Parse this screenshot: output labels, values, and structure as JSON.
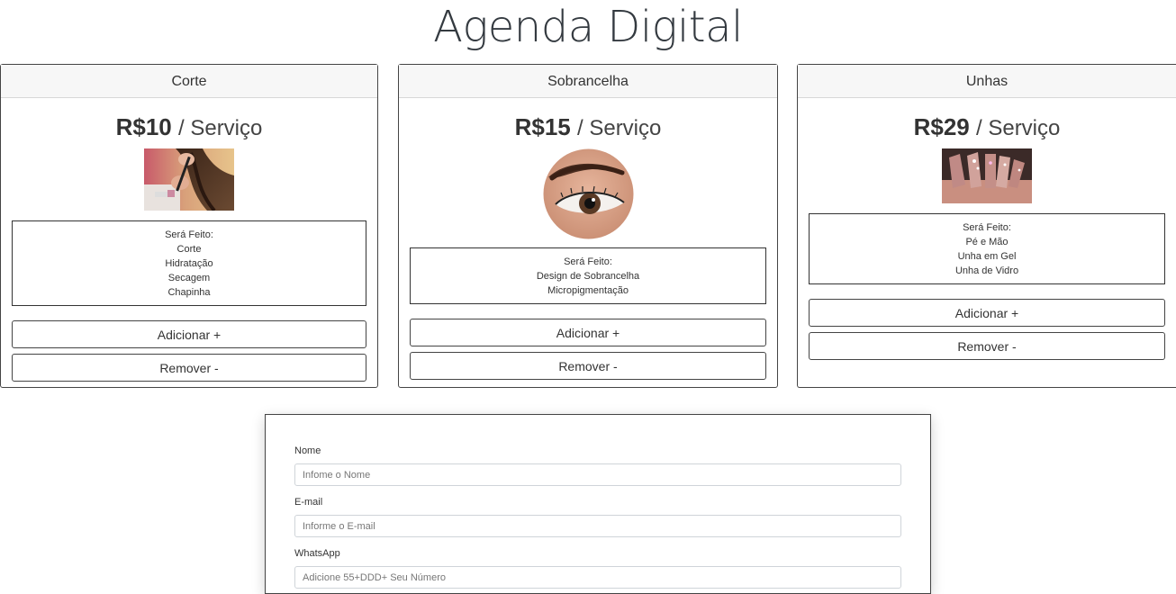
{
  "page": {
    "title": "Agenda Digital"
  },
  "cards": [
    {
      "header": "Corte",
      "price": "R$10",
      "per": "/ Serviço",
      "desc_title": "Será Feito:",
      "items": [
        "Corte",
        "Hidratação",
        "Secagem",
        "Chapinha"
      ],
      "add_label": "Adicionar +",
      "remove_label": "Remover -"
    },
    {
      "header": "Sobrancelha",
      "price": "R$15",
      "per": "/ Serviço",
      "desc_title": "Será Feito:",
      "items": [
        "Design de Sobrancelha",
        "Micropigmentação"
      ],
      "add_label": "Adicionar +",
      "remove_label": "Remover -"
    },
    {
      "header": "Unhas",
      "price": "R$29",
      "per": "/ Serviço",
      "desc_title": "Será Feito:",
      "items": [
        "Pé e Mão",
        "Unha em Gel",
        "Unha de Vidro"
      ],
      "add_label": "Adicionar +",
      "remove_label": "Remover -"
    }
  ],
  "form": {
    "name_label": "Nome",
    "name_placeholder": "Infome o Nome",
    "email_label": "E-mail",
    "email_placeholder": "Informe o E-mail",
    "whatsapp_label": "WhatsApp",
    "whatsapp_placeholder": "Adicione 55+DDD+ Seu Número"
  },
  "icons": {
    "hair-icon": "hair-cut-photo",
    "eyebrow-icon": "eyebrow-photo",
    "nails-icon": "nails-photo"
  }
}
